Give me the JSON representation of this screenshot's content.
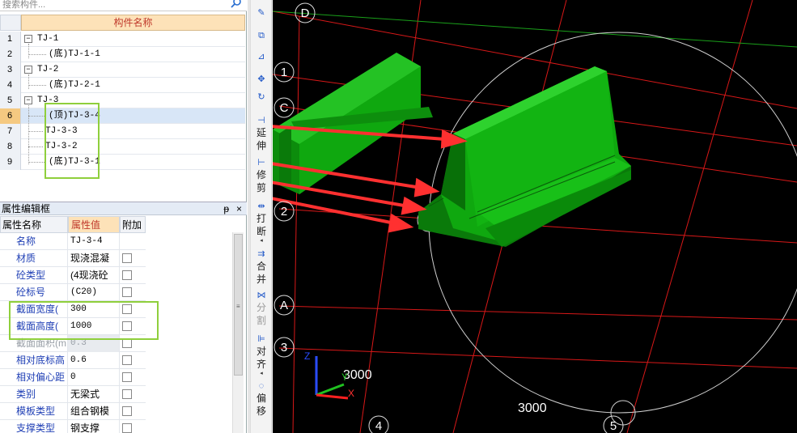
{
  "search": {
    "placeholder": "搜索构件..."
  },
  "tree": {
    "header": "构件名称",
    "rows": [
      {
        "num": "1",
        "label": "TJ-1"
      },
      {
        "num": "2",
        "label": "(底)TJ-1-1"
      },
      {
        "num": "3",
        "label": "TJ-2"
      },
      {
        "num": "4",
        "label": "(底)TJ-2-1"
      },
      {
        "num": "5",
        "label": "TJ-3"
      },
      {
        "num": "6",
        "label": "(顶)TJ-3-4"
      },
      {
        "num": "7",
        "label": "TJ-3-3"
      },
      {
        "num": "8",
        "label": "TJ-3-2"
      },
      {
        "num": "9",
        "label": "(底)TJ-3-1"
      }
    ],
    "collapse_sign": "−"
  },
  "props_panel": {
    "title": "属性编辑框",
    "pin": "ᵽ",
    "close": "×",
    "col_name": "属性名称",
    "col_value": "属性值",
    "col_extra": "附加",
    "rows": [
      {
        "name": "名称",
        "value": "TJ-3-4",
        "checkbox": false
      },
      {
        "name": "材质",
        "value": "现浇混凝",
        "checkbox": true
      },
      {
        "name": "砼类型",
        "value": "(4现浇砼",
        "checkbox": true
      },
      {
        "name": "砼标号",
        "value": "(C20)",
        "checkbox": true
      },
      {
        "name": "截面宽度(",
        "value": "300",
        "checkbox": true
      },
      {
        "name": "截面高度(",
        "value": "1000",
        "checkbox": true
      },
      {
        "name": "截面面积(m",
        "value": "0.3",
        "checkbox": true
      },
      {
        "name": "相对底标高",
        "value": "0.6",
        "checkbox": true
      },
      {
        "name": "相对偏心距",
        "value": "0",
        "checkbox": true
      },
      {
        "name": "类别",
        "value": "无梁式",
        "checkbox": true
      },
      {
        "name": "模板类型",
        "value": "组合钢模",
        "checkbox": true
      },
      {
        "name": "支撑类型",
        "value": "钢支撑",
        "checkbox": true
      }
    ]
  },
  "toolbar": [
    {
      "icon": "brush-icon",
      "glyph": "✎",
      "text": ""
    },
    {
      "icon": "copy-icon",
      "glyph": "⧉",
      "text": ""
    },
    {
      "icon": "mirror-icon",
      "glyph": "⊿",
      "text": ""
    },
    {
      "icon": "move-icon",
      "glyph": "✥",
      "text": ""
    },
    {
      "icon": "rotate-icon",
      "glyph": "↻",
      "text": ""
    },
    {
      "icon": "extend-icon",
      "glyph": "⊣",
      "text": "延伸"
    },
    {
      "icon": "trim-icon",
      "glyph": "⊢",
      "text": "修剪"
    },
    {
      "icon": "break-icon",
      "glyph": "⇹",
      "text": "打断"
    },
    {
      "icon": "merge-icon",
      "glyph": "⇉",
      "text": "合并"
    },
    {
      "icon": "split-icon",
      "glyph": "⋈",
      "text": "分割"
    },
    {
      "icon": "align-icon",
      "glyph": "⊫",
      "text": "对齐"
    },
    {
      "icon": "offset-icon",
      "glyph": "◌",
      "text": "偏移"
    }
  ],
  "viewport": {
    "axis_labels": [
      "D",
      "1",
      "C",
      "2",
      "A",
      "3",
      "4",
      "5"
    ],
    "dimensions": [
      "3000",
      "3000"
    ],
    "axes": {
      "x": "X",
      "y": "Y",
      "z": "Z"
    },
    "colors": {
      "background": "#000000",
      "grid": "#d81818",
      "solid": "#0faa0f",
      "arrow": "#ff3030",
      "highlight": "#8fcf3c"
    }
  }
}
